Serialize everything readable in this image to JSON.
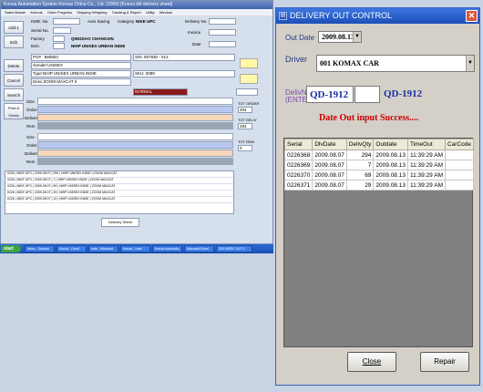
{
  "background_app": {
    "title": "Konoa Automation System  Koreas China Co., Ltd. (2009)  [Konoa bill delivery sheet]",
    "menu": [
      "Sales Master",
      "Kolonis",
      "Order Progress",
      "Shipping Weighing",
      "Tracking & Report",
      "Utility",
      "Window"
    ],
    "side_buttons": [
      "Add-1",
      "Edit",
      "Delete",
      "Cancel",
      "Search",
      "Print & Check"
    ],
    "kmr_label": "KMR. No.",
    "auto_saving": "Auto Saving",
    "category_label": "Category",
    "category_value": "NIKE UPC",
    "delivery_label": "Delivery No.",
    "invoice_label": "Invoice",
    "date_label": "Date",
    "serial_label": "Serial No.",
    "factory_label": "Factory",
    "factory_value": "QINGDAO CHANGXIN",
    "item_label": "Item",
    "item_value": "NHIP UNISEX URBAN INDIE",
    "po_value": "PO# : 880853",
    "sn_value": "S/N: 557830 - 013",
    "gender_value": "Gender:UNISEX",
    "type_value": "Type:NHIP UNISEX URBAN INDIE",
    "sku_value": "SKU: 0089",
    "desc_value": "Desc:ZOOM MAXCAT II",
    "normal_value": "NORMAL",
    "rows": [
      "Size",
      "Order",
      "Delivery",
      "Rem"
    ],
    "tot_order_label": "TOT ORDER",
    "tot_order_value": "294",
    "tot_deliv_label": "TOT DELIV",
    "tot_deliv_value": "294",
    "tot_rem_label": "TOT REM",
    "tot_rem_value": "0",
    "list_rows": [
      "0226 | NIKE UPC | 2009.08.07 | 294 | NHIP UNISEX INDIE | ZOOM MAXCAT",
      "0226 | NIKE UPC | 2009.08.07 | 7 | NHIP UNISEX INDIE | ZOOM MAXCAT",
      "0226 | NIKE UPC | 2009.08.07 | 69 | NHIP UNISEX INDIE | ZOOM MAXCAT",
      "0226 | NIKE UPC | 2009.08.07 | 29 | NHIP UNISEX INDIE | ZOOM MAXCAT",
      "0226 | NIKE UPC | 2009.08.07 | 12 | NHIP UNISEX INDIE | ZOOM MAXCAT"
    ],
    "sheet_tab": "Delivery Sheet",
    "taskbar": {
      "start": "start",
      "tasks": [
        "Inbox - Outlook",
        "Konoa - Excel",
        "note - Microsoft",
        "Konoa - Note",
        "Konoa Automatio",
        "Microsoft Excel",
        "DELIVERY OUT C"
      ]
    }
  },
  "dialog": {
    "title": "DELIVERY OUT CONTROL",
    "close_glyph": "✕",
    "out_date_label": "Out Date",
    "out_date_value": "2009.08.13",
    "driver_label": "Driver",
    "driver_value": "001   KOMAX CAR",
    "delivno_label": "DelivNo :",
    "enter_label": "(ENTER)",
    "delivno_value": "QD-1912",
    "delivno_display": "QD-1912",
    "success_message": "Date Out input Success....",
    "grid_headers": [
      "Serial",
      "DlvDate",
      "DelivQty",
      "Outdate",
      "TimeOut",
      "CarCode"
    ],
    "grid_rows": [
      [
        "0226368",
        "2009.08.07",
        "294",
        "2009.08.13",
        "11:39:29 AM",
        ""
      ],
      [
        "0226369",
        "2009.08.07",
        "7",
        "2009.08.13",
        "11:39:29 AM",
        ""
      ],
      [
        "0226370",
        "2009.08.07",
        "69",
        "2009.08.13",
        "11:39:29 AM",
        ""
      ],
      [
        "0226371",
        "2009.08.07",
        "29",
        "2009.08.13",
        "11:39:29 AM",
        ""
      ]
    ],
    "close_button": "Close",
    "repair_button": "Repair"
  },
  "colors": {
    "title_blue": "#1c4fb8",
    "success_red": "#cc0000",
    "delivno_blue": "#1a2fa0",
    "normal_red": "#8b1a1a",
    "order_row": "#b8c8f0",
    "delivery_row": "#f6d6b8",
    "rem_row": "#9aa6b4"
  }
}
